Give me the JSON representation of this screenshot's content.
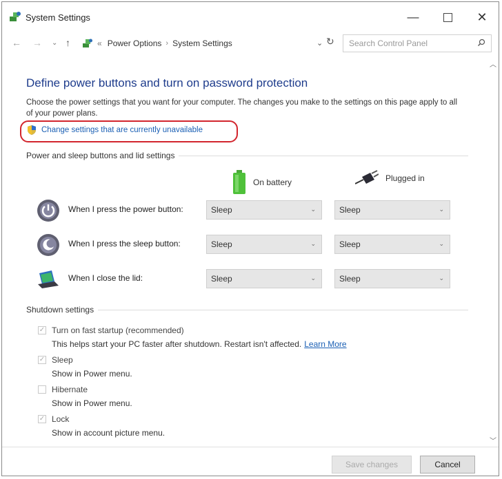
{
  "window": {
    "title": "System Settings",
    "controls": {
      "minimize": "—",
      "maximize": "",
      "close": "✕"
    }
  },
  "address_bar": {
    "nav": {
      "back": "←",
      "forward": "→",
      "recent": "⌄",
      "up": "↑"
    },
    "overflow": "«",
    "breadcrumb": [
      "Power Options",
      "System Settings"
    ],
    "separator": "›",
    "dropdown": "⌄",
    "refresh": "↻",
    "search_placeholder": "Search Control Panel"
  },
  "main": {
    "heading": "Define power buttons and turn on password protection",
    "description": "Choose the power settings that you want for your computer. The changes you make to the settings on this page apply to all of your power plans.",
    "change_link": "Change settings that are currently unavailable",
    "power_section": {
      "label": "Power and sleep buttons and lid settings",
      "columns": [
        "On battery",
        "Plugged in"
      ],
      "rows": [
        {
          "label": "When I press the power button:",
          "on_battery": "Sleep",
          "plugged_in": "Sleep"
        },
        {
          "label": "When I press the sleep button:",
          "on_battery": "Sleep",
          "plugged_in": "Sleep"
        },
        {
          "label": "When I close the lid:",
          "on_battery": "Sleep",
          "plugged_in": "Sleep"
        }
      ]
    },
    "shutdown_section": {
      "label": "Shutdown settings",
      "items": [
        {
          "label": "Turn on fast startup (recommended)",
          "checked": true,
          "sub": "This helps start your PC faster after shutdown. Restart isn't affected.",
          "link": "Learn More"
        },
        {
          "label": "Sleep",
          "checked": true,
          "sub": "Show in Power menu."
        },
        {
          "label": "Hibernate",
          "checked": false,
          "sub": "Show in Power menu."
        },
        {
          "label": "Lock",
          "checked": true,
          "sub": "Show in account picture menu."
        }
      ]
    }
  },
  "footer": {
    "save": "Save changes",
    "cancel": "Cancel"
  },
  "colors": {
    "heading": "#1e3c8c",
    "link": "#1a5fb4",
    "highlight": "#d2242c"
  }
}
